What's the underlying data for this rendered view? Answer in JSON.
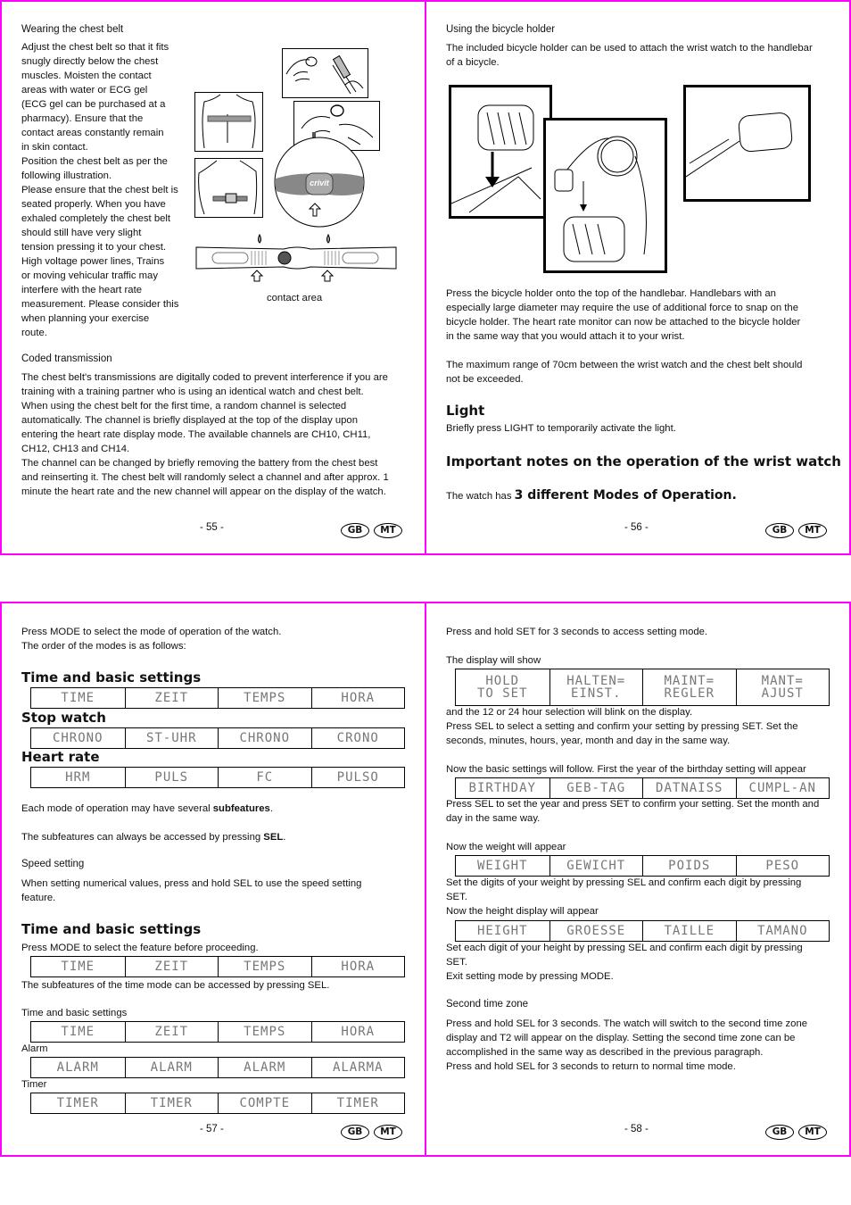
{
  "badges": [
    "GB",
    "MT"
  ],
  "page55": {
    "title": "Wearing the chest belt",
    "lines": [
      "Adjust the chest belt so that it fits",
      "snugly directly below the chest",
      "muscles. Moisten the contact",
      "areas with water or ECG gel",
      "(ECG gel can be purchased at a",
      "pharmacy). Ensure that the",
      "contact areas constantly remain",
      "in skin contact.",
      "Position the chest belt as per the",
      "following illustration.",
      "Please ensure that the chest belt is",
      "seated properly. When you have",
      "exhaled completely the chest belt",
      "should still have very slight",
      "tension pressing it to your chest.",
      "High voltage power lines, Trains",
      "or moving vehicular traffic may",
      "interfere with the heart rate",
      "measurement. Please consider this",
      "when planning your exercise",
      "route."
    ],
    "contact_area_label": "contact area",
    "brand_label": "crivit",
    "coded_title": "Coded transmission",
    "coded_lines": [
      "The chest belt's transmissions are digitally coded to prevent interference if you are",
      "training with a training partner who is using an identical watch and chest belt.",
      "When using the chest belt for the first time, a random channel is selected",
      "automatically. The channel is briefly displayed at the top of the display upon",
      "entering the heart rate display mode. The available channels are CH10, CH11,",
      "CH12, CH13 and CH14.",
      "The channel can be changed by briefly removing the battery from the chest best",
      "and reinserting it. The chest belt will randomly select a channel and after approx. 1",
      "minute the heart rate and the new channel will appear on the display of the watch."
    ],
    "page_number": "- 55 -"
  },
  "page56": {
    "title": "Using the bicycle holder",
    "intro_lines": [
      "The included bicycle holder can be used to attach the wrist watch to the handlebar",
      "of a bicycle."
    ],
    "press_lines": [
      "Press the bicycle holder onto the top of the handlebar. Handlebars with an",
      "especially large diameter may require the use of additional force to snap on the",
      "bicycle holder. The heart rate monitor can now be attached to the bicycle holder",
      "in the same way that you would attach it to your wrist."
    ],
    "range_lines": [
      "The maximum range of 70cm between the wrist watch and the chest belt should",
      "not be exceeded."
    ],
    "light_title": "Light",
    "light_pre": "Briefly press ",
    "light_key": "LIGHT",
    "light_post": " to temporarily activate the light.",
    "important_title": "Important notes on the operation of the wrist watch",
    "modes_pre": "The watch has ",
    "modes_bold": "3 different Modes of Operation.",
    "page_number": "- 56 -"
  },
  "page57": {
    "intro1_pre": "Press ",
    "intro1_key": "MODE",
    "intro1_post": " to select the mode of operation of the watch.",
    "intro2": "The order of the modes is as follows:",
    "mode_sections": [
      {
        "title": "Time and basic settings",
        "lcd": [
          "TIME",
          "ZEIT",
          "TEMPS",
          "HORA"
        ]
      },
      {
        "title": "Stop watch",
        "lcd": [
          "CHRONO",
          "ST-UHR",
          "CHRONO",
          "CRONO"
        ]
      },
      {
        "title": "Heart rate",
        "lcd": [
          "HRM",
          "PULS",
          "FC",
          "PULSO"
        ]
      }
    ],
    "subfeatures_pre": "Each mode of operation may have several ",
    "subfeatures_bold": "subfeatures",
    "subfeatures_post": ".",
    "access_pre": "The subfeatures can always be accessed by pressing ",
    "access_key": "SEL",
    "access_post": ".",
    "speed_title": "Speed setting",
    "speed_l1_pre": "When setting numerical values, press and hold ",
    "speed_l1_key": "SEL",
    "speed_l1_post": " to use the speed setting",
    "speed_l2": "feature.",
    "time_title": "Time and basic settings",
    "time_pre": "Press ",
    "time_key": "MODE",
    "time_post": " to select the feature before proceeding.",
    "time_lcd": [
      "TIME",
      "ZEIT",
      "TEMPS",
      "HORA"
    ],
    "time_sub_pre": "The subfeatures of the time mode can be accessed by pressing ",
    "time_sub_key": "SEL",
    "time_sub_post": ".",
    "sub_sections": [
      {
        "title": "Time and basic settings",
        "lcd": [
          "TIME",
          "ZEIT",
          "TEMPS",
          "HORA"
        ]
      },
      {
        "title": "Alarm",
        "lcd": [
          "ALARM",
          "ALARM",
          "ALARM",
          "ALARMA"
        ]
      },
      {
        "title": "Timer",
        "lcd": [
          "TIMER",
          "TIMER",
          "COMPTE",
          "TIMER"
        ]
      }
    ],
    "page_number": "- 57 -"
  },
  "page58": {
    "hold_pre": "Press and hold ",
    "hold_key": "SET",
    "hold_post": " for 3 seconds to access setting mode.",
    "display_show": "The display will show",
    "hold_lcd": [
      "HOLD\nTO SET",
      "HALTEN=\nEINST.",
      "MAINT=\nREGLER",
      "MANT=\nAJUST"
    ],
    "blink_line": "and the 12 or 24 hour selection will blink on the display.",
    "sel_l1_pre": "Press ",
    "sel_l1_key1": "SEL",
    "sel_l1_mid": " to select a setting and confirm your setting by pressing ",
    "sel_l1_key2": "SET",
    "sel_l1_post": ". Set the",
    "sel_l2": "seconds, minutes, hours, year, month and day in the same way.",
    "basic_line": "Now the basic settings will follow. First the year of the birthday setting will appear",
    "birthday_lcd": [
      "BIRTHDAY",
      "GEB-TAG",
      "DATNAISS",
      "CUMPL-AN"
    ],
    "year_l1_pre": "Press ",
    "year_l1_key1": "SEL",
    "year_l1_mid": " to set the year and press ",
    "year_l1_key2": "SET",
    "year_l1_post": " to confirm your setting. Set the month and",
    "year_l2": "day in the same way.",
    "weight_line": "Now the weight will appear",
    "weight_lcd": [
      "WEIGHT",
      "GEWICHT",
      "POIDS",
      "PESO"
    ],
    "weight_l1_pre": "Set the digits of your weight by pressing ",
    "weight_l1_key": "SEL",
    "weight_l1_post": " and confirm each digit by pressing",
    "weight_l2_key": "SET",
    "weight_l2_post": ".",
    "height_line": "Now the height display will appear",
    "height_lcd": [
      "HEIGHT",
      "GROESSE",
      "TAILLE",
      "TAMANO"
    ],
    "height_l1_pre": "Set each digit of your height by pressing ",
    "height_l1_key": "SEL",
    "height_l1_post": " and confirm each digit by pressing",
    "height_l2_key": "SET",
    "height_l2_post": ".",
    "exit_pre": "Exit setting mode by pressing ",
    "exit_key": "MODE",
    "exit_post": ".",
    "tz_title": "Second time zone",
    "tz_l1_pre": "Press and hold ",
    "tz_l1_key": "SEL",
    "tz_l1_post": " for 3 seconds. The watch will switch to the second time zone",
    "tz_l2": "display and T2 will appear on the display. Setting the second time zone can be",
    "tz_l3": "accomplished in the same way as described in the previous paragraph.",
    "tz_l4_pre": "Press and hold ",
    "tz_l4_key": "SEL",
    "tz_l4_post": " for 3 seconds to return to normal time mode.",
    "page_number": "- 58 -"
  }
}
